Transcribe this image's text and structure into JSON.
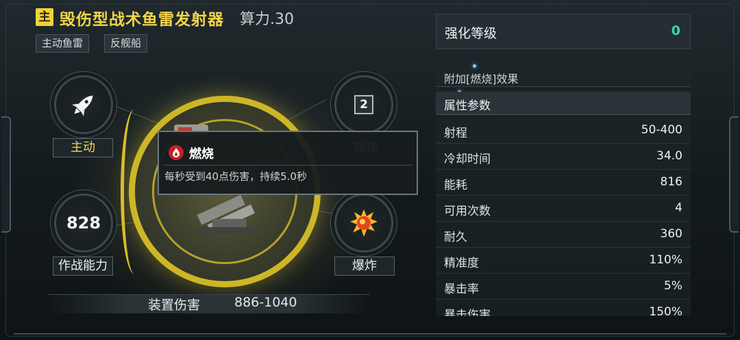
{
  "header": {
    "tag": "主",
    "title": "毁伤型战术鱼雷发射器",
    "power": "算力.30",
    "chips": [
      "主动鱼雷",
      "反舰船"
    ]
  },
  "stats": {
    "top_left_label": "主动",
    "top_right_value": "2",
    "top_right_label": "规格",
    "bottom_left_value": "828",
    "bottom_left_label": "作战能力",
    "bottom_right_label": "爆炸"
  },
  "tooltip": {
    "title": "燃烧",
    "description": "每秒受到40点伤害，持续5.0秒"
  },
  "damage": {
    "label": "装置伤害",
    "value": "886-1040"
  },
  "enhance": {
    "label": "强化等级",
    "value": "0"
  },
  "effect": "附加[燃烧]效果",
  "attributes": {
    "header": "属性参数",
    "rows": [
      {
        "name": "射程",
        "value": "50-400"
      },
      {
        "name": "冷却时间",
        "value": "34.0"
      },
      {
        "name": "能耗",
        "value": "816"
      },
      {
        "name": "可用次数",
        "value": "4"
      },
      {
        "name": "耐久",
        "value": "360"
      },
      {
        "name": "精准度",
        "value": "110%"
      },
      {
        "name": "暴击率",
        "value": "5%"
      },
      {
        "name": "暴击伤害",
        "value": "150%"
      }
    ]
  },
  "colors": {
    "accent_gold": "#f1d54a",
    "enhance_value": "#38d6b9",
    "burn_red": "#c2202a"
  },
  "icons": [
    "rocket-icon",
    "spec-box-icon",
    "explosion-icon",
    "fire-icon"
  ]
}
